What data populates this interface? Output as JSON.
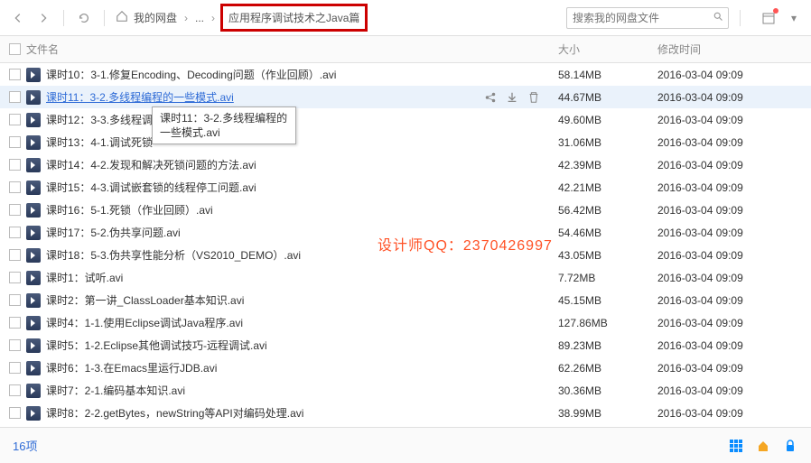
{
  "breadcrumb": {
    "root": "我的网盘",
    "mid": "...",
    "current": "应用程序调试技术之Java篇"
  },
  "search_placeholder": "搜索我的网盘文件",
  "columns": {
    "name": "文件名",
    "size": "大小",
    "mtime": "修改时间"
  },
  "tooltip": "课时11：3-2.多线程编程的一些模式.avi",
  "watermark": "设计师QQ：2370426997",
  "files": [
    {
      "name": "课时10：3-1.修复Encoding、Decoding问题（作业回顾）.avi",
      "size": "58.14MB",
      "mtime": "2016-03-04 09:09"
    },
    {
      "name": "课时11：3-2.多线程编程的一些模式.avi",
      "size": "44.67MB",
      "mtime": "2016-03-04 09:09",
      "hovered": true
    },
    {
      "name": "课时12：3-3.多线程调试",
      "size": "49.60MB",
      "mtime": "2016-03-04 09:09"
    },
    {
      "name": "课时13：4-1.调试死锁",
      "size": "31.06MB",
      "mtime": "2016-03-04 09:09"
    },
    {
      "name": "课时14：4-2.发现和解决死锁问题的方法.avi",
      "size": "42.39MB",
      "mtime": "2016-03-04 09:09"
    },
    {
      "name": "课时15：4-3.调试嵌套锁的线程停工问题.avi",
      "size": "42.21MB",
      "mtime": "2016-03-04 09:09"
    },
    {
      "name": "课时16：5-1.死锁（作业回顾）.avi",
      "size": "56.42MB",
      "mtime": "2016-03-04 09:09"
    },
    {
      "name": "课时17：5-2.伪共享问题.avi",
      "size": "54.46MB",
      "mtime": "2016-03-04 09:09"
    },
    {
      "name": "课时18：5-3.伪共享性能分析（VS2010_DEMO）.avi",
      "size": "43.05MB",
      "mtime": "2016-03-04 09:09"
    },
    {
      "name": "课时1：试听.avi",
      "size": "7.72MB",
      "mtime": "2016-03-04 09:09"
    },
    {
      "name": "课时2：第一讲_ClassLoader基本知识.avi",
      "size": "45.15MB",
      "mtime": "2016-03-04 09:09"
    },
    {
      "name": "课时4：1-1.使用Eclipse调试Java程序.avi",
      "size": "127.86MB",
      "mtime": "2016-03-04 09:09"
    },
    {
      "name": "课时5：1-2.Eclipse其他调试技巧-远程调试.avi",
      "size": "89.23MB",
      "mtime": "2016-03-04 09:09"
    },
    {
      "name": "课时6：1-3.在Emacs里运行JDB.avi",
      "size": "62.26MB",
      "mtime": "2016-03-04 09:09"
    },
    {
      "name": "课时7：2-1.编码基本知识.avi",
      "size": "30.36MB",
      "mtime": "2016-03-04 09:09"
    },
    {
      "name": "课时8：2-2.getBytes，newString等API对编码处理.avi",
      "size": "38.99MB",
      "mtime": "2016-03-04 09:09"
    }
  ],
  "footer_count": "16项"
}
